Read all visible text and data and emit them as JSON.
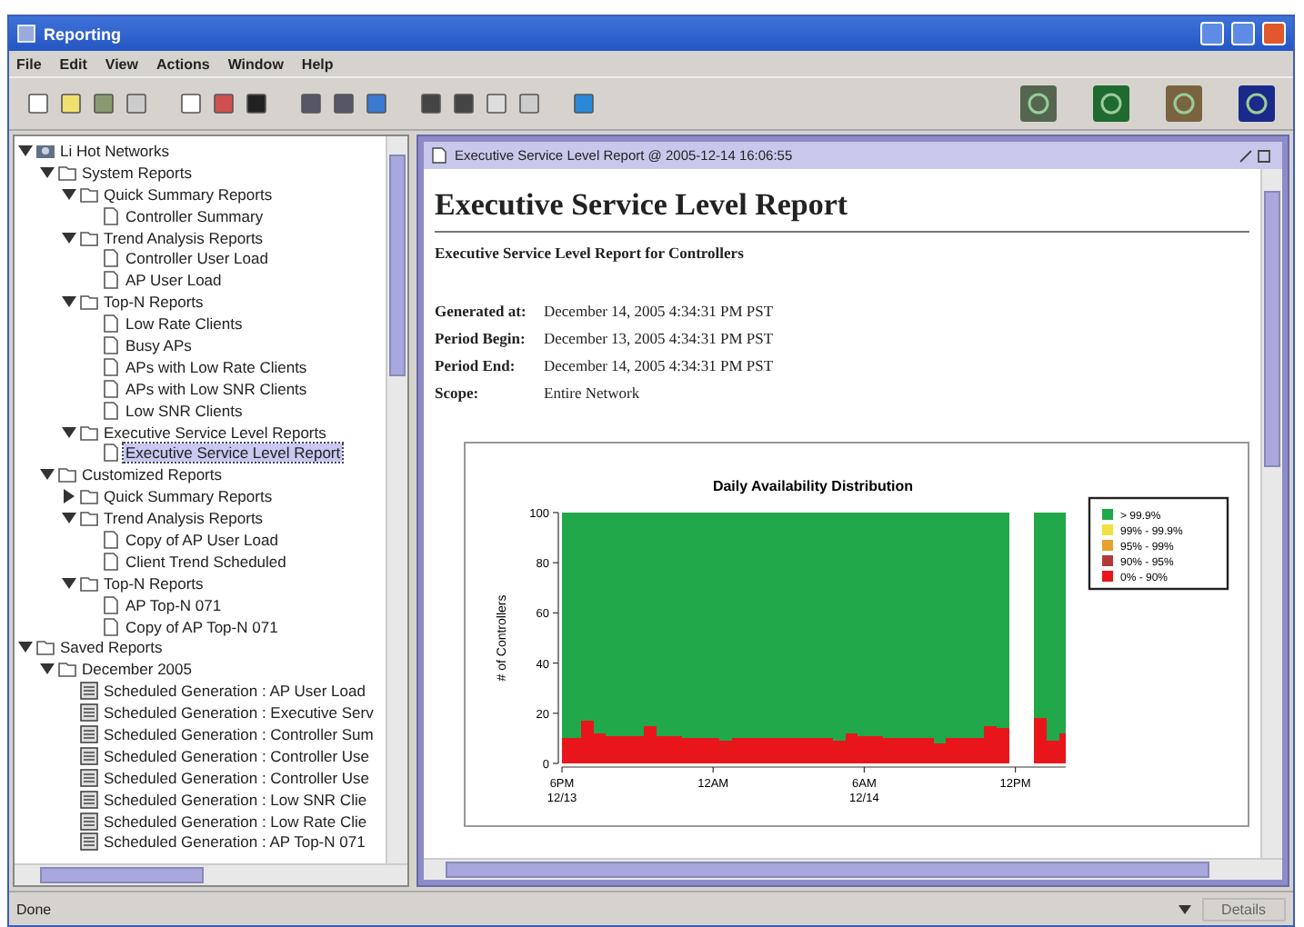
{
  "window": {
    "title": "Reporting"
  },
  "menu": [
    "File",
    "Edit",
    "View",
    "Actions",
    "Window",
    "Help"
  ],
  "tree": [
    {
      "label": "Li Hot Networks",
      "kind": "network",
      "expanded": true,
      "selected": false,
      "children": [
        {
          "label": "System Reports",
          "kind": "folder",
          "expanded": true,
          "selected": false,
          "children": [
            {
              "label": "Quick Summary Reports",
              "kind": "folder",
              "expanded": true,
              "selected": false,
              "children": [
                {
                  "label": "Controller Summary",
                  "kind": "report",
                  "selected": false
                }
              ]
            },
            {
              "label": "Trend Analysis Reports",
              "kind": "folder",
              "expanded": true,
              "selected": false,
              "children": [
                {
                  "label": "Controller User Load",
                  "kind": "report",
                  "selected": false
                },
                {
                  "label": "AP User Load",
                  "kind": "report",
                  "selected": false
                }
              ]
            },
            {
              "label": "Top-N Reports",
              "kind": "folder",
              "expanded": true,
              "selected": false,
              "children": [
                {
                  "label": "Low Rate Clients",
                  "kind": "report",
                  "selected": false
                },
                {
                  "label": "Busy APs",
                  "kind": "report",
                  "selected": false
                },
                {
                  "label": "APs with Low Rate Clients",
                  "kind": "report",
                  "selected": false
                },
                {
                  "label": "APs with Low SNR Clients",
                  "kind": "report",
                  "selected": false
                },
                {
                  "label": "Low SNR Clients",
                  "kind": "report",
                  "selected": false
                }
              ]
            },
            {
              "label": "Executive Service Level Reports",
              "kind": "folder",
              "expanded": true,
              "selected": false,
              "children": [
                {
                  "label": "Executive Service Level Report",
                  "kind": "report",
                  "selected": true
                }
              ]
            }
          ]
        },
        {
          "label": "Customized Reports",
          "kind": "folder",
          "expanded": true,
          "selected": false,
          "children": [
            {
              "label": "Quick Summary Reports",
              "kind": "folder",
              "expanded": false,
              "selected": false
            },
            {
              "label": "Trend Analysis Reports",
              "kind": "folder",
              "expanded": true,
              "selected": false,
              "children": [
                {
                  "label": "Copy of AP User Load",
                  "kind": "report",
                  "selected": false
                },
                {
                  "label": "Client Trend Scheduled",
                  "kind": "report",
                  "selected": false
                }
              ]
            },
            {
              "label": "Top-N Reports",
              "kind": "folder",
              "expanded": true,
              "selected": false,
              "children": [
                {
                  "label": "AP Top-N 071",
                  "kind": "report",
                  "selected": false
                },
                {
                  "label": "Copy of AP Top-N 071",
                  "kind": "report",
                  "selected": false
                }
              ]
            }
          ]
        }
      ]
    },
    {
      "label": "Saved Reports",
      "kind": "folder",
      "expanded": true,
      "selected": false,
      "children": [
        {
          "label": "December 2005",
          "kind": "folder",
          "expanded": true,
          "selected": false,
          "children": [
            {
              "label": "Scheduled Generation : AP User Load",
              "kind": "saved",
              "selected": false
            },
            {
              "label": "Scheduled Generation : Executive Serv",
              "kind": "saved",
              "selected": false
            },
            {
              "label": "Scheduled Generation : Controller Sum",
              "kind": "saved",
              "selected": false
            },
            {
              "label": "Scheduled Generation : Controller Use",
              "kind": "saved",
              "selected": false
            },
            {
              "label": "Scheduled Generation : Controller Use",
              "kind": "saved",
              "selected": false
            },
            {
              "label": "Scheduled Generation : Low SNR Clie",
              "kind": "saved",
              "selected": false
            },
            {
              "label": "Scheduled Generation : Low Rate Clie",
              "kind": "saved",
              "selected": false
            },
            {
              "label": "Scheduled Generation : AP Top-N 071",
              "kind": "saved",
              "selected": false
            }
          ]
        }
      ]
    }
  ],
  "report": {
    "frame_title": "Executive Service Level Report @ 2005-12-14 16:06:55",
    "heading": "Executive Service Level Report",
    "subtitle": "Executive Service Level Report for Controllers",
    "fields": [
      {
        "label": "Generated at:",
        "value": "December 14, 2005 4:34:31 PM PST"
      },
      {
        "label": "Period Begin:",
        "value": "December 13, 2005 4:34:31 PM PST"
      },
      {
        "label": "Period End:",
        "value": "December 14, 2005 4:34:31 PM PST"
      },
      {
        "label": "Scope:",
        "value": "Entire Network"
      }
    ],
    "chart_data": {
      "type": "area",
      "title": "Daily Availability Distribution",
      "ylabel": "# of Controllers",
      "stacked": true,
      "categories": [
        "6PM 12/13",
        null,
        null,
        null,
        null,
        null,
        null,
        null,
        null,
        null,
        null,
        null,
        "12AM",
        null,
        null,
        null,
        null,
        null,
        null,
        null,
        null,
        null,
        null,
        null,
        "6AM 12/14",
        null,
        null,
        null,
        null,
        null,
        null,
        null,
        null,
        null,
        null,
        null,
        "12PM",
        null,
        null,
        null,
        null
      ],
      "legend": "right",
      "ylim": [
        0,
        100
      ],
      "yticks": [
        0,
        20,
        40,
        60,
        80,
        100
      ],
      "series": [
        {
          "name": "0% - 90%",
          "color": "#e8161b",
          "values": [
            10,
            10,
            17,
            12,
            11,
            11,
            11,
            15,
            11,
            11,
            10,
            10,
            10,
            9,
            10,
            10,
            10,
            10,
            10,
            10,
            10,
            10,
            9,
            12,
            11,
            11,
            10,
            10,
            10,
            10,
            8,
            10,
            10,
            10,
            15,
            14,
            null,
            null,
            18,
            9,
            12
          ]
        },
        {
          "name": "90% - 95%",
          "color": "#b03a3a",
          "values": [
            null,
            null,
            null,
            null,
            null,
            null,
            null,
            null,
            null,
            null,
            null,
            null,
            null,
            null,
            null,
            null,
            null,
            null,
            null,
            null,
            null,
            null,
            null,
            null,
            null,
            null,
            null,
            null,
            null,
            null,
            null,
            null,
            null,
            null,
            null,
            null,
            null,
            null,
            null,
            null,
            null
          ]
        },
        {
          "name": "95% - 99%",
          "color": "#e8a030",
          "values": [
            null,
            null,
            null,
            null,
            null,
            null,
            null,
            null,
            null,
            null,
            null,
            null,
            null,
            null,
            null,
            null,
            null,
            null,
            null,
            null,
            null,
            null,
            null,
            null,
            null,
            null,
            null,
            null,
            null,
            null,
            null,
            null,
            null,
            null,
            null,
            null,
            null,
            null,
            null,
            null,
            null
          ]
        },
        {
          "name": "99% - 99.9%",
          "color": "#f0e040",
          "values": [
            null,
            null,
            null,
            null,
            null,
            null,
            null,
            null,
            null,
            null,
            null,
            null,
            null,
            null,
            null,
            null,
            null,
            null,
            null,
            null,
            null,
            null,
            null,
            null,
            null,
            null,
            null,
            null,
            null,
            null,
            null,
            null,
            null,
            null,
            null,
            null,
            null,
            null,
            null,
            null,
            null
          ]
        },
        {
          "name": "> 99.9%",
          "color": "#20a84a",
          "values": [
            90,
            90,
            83,
            88,
            89,
            89,
            89,
            85,
            89,
            89,
            90,
            90,
            90,
            91,
            90,
            90,
            90,
            90,
            90,
            90,
            90,
            90,
            91,
            88,
            89,
            89,
            90,
            90,
            90,
            90,
            92,
            90,
            90,
            90,
            85,
            86,
            null,
            null,
            82,
            91,
            88
          ]
        }
      ]
    }
  },
  "status_bar": {
    "text": "Done",
    "button": {
      "label": "Details",
      "disabled": true
    }
  }
}
